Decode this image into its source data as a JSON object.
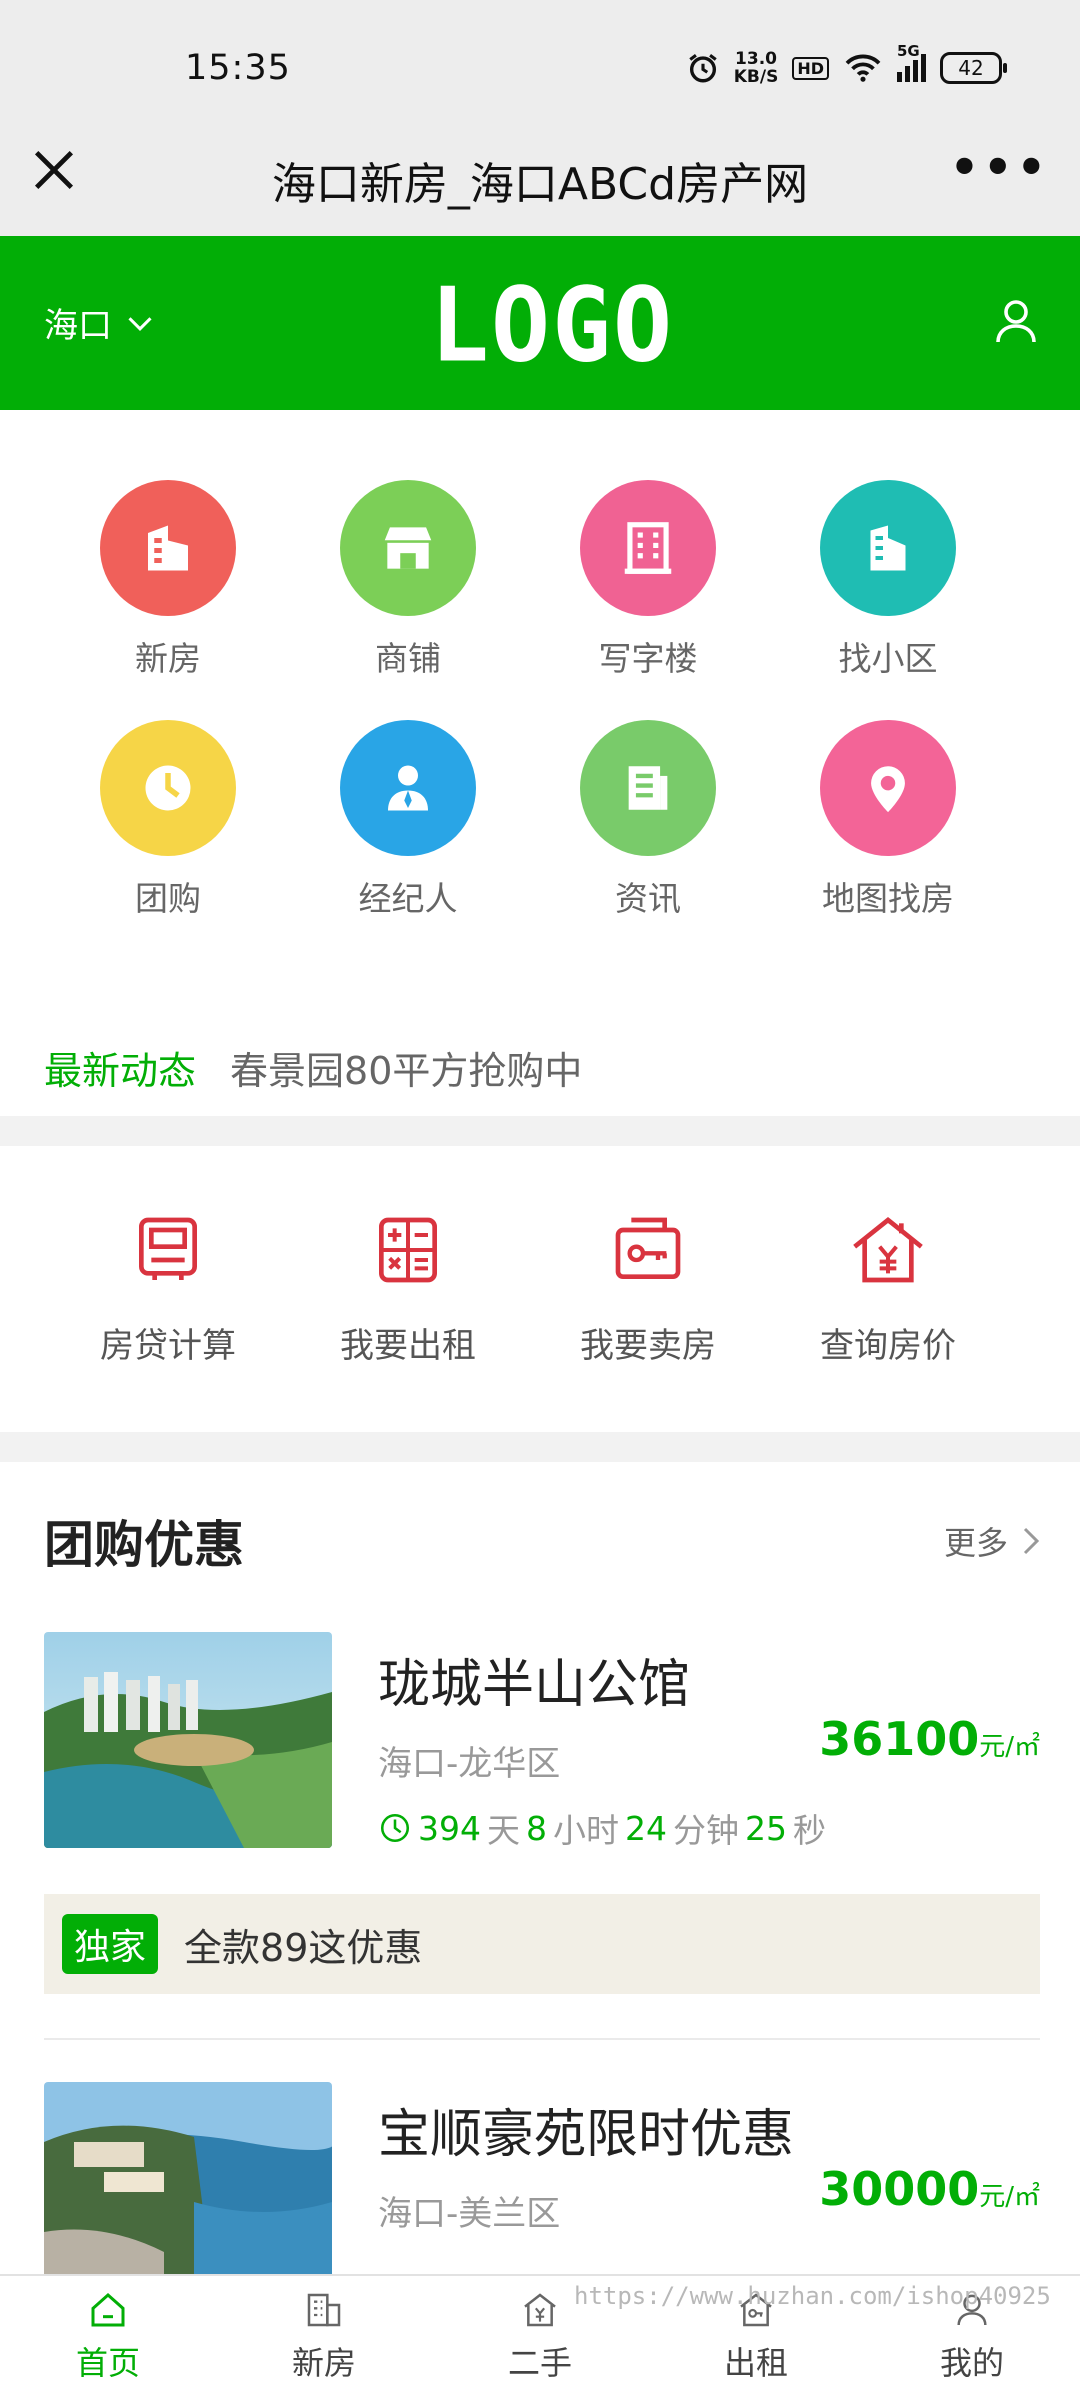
{
  "status": {
    "time": "15:35",
    "net_speed_value": "13.0",
    "net_speed_unit": "KB/S",
    "hd": "HD",
    "signal": "5G",
    "battery": "42"
  },
  "titlebar": {
    "title": "海口新房_海口ABCd房产网"
  },
  "header": {
    "city": "海口",
    "logo_text": "LOGO"
  },
  "grid": [
    {
      "label": "新房",
      "color": "#f0605a",
      "icon": "building-icon"
    },
    {
      "label": "商铺",
      "color": "#7ccf57",
      "icon": "shop-icon"
    },
    {
      "label": "写字楼",
      "color": "#f06293",
      "icon": "office-icon"
    },
    {
      "label": "找小区",
      "color": "#1fbdb3",
      "icon": "community-icon"
    },
    {
      "label": "团购",
      "color": "#f6d547",
      "icon": "clock-icon"
    },
    {
      "label": "经纪人",
      "color": "#29a5e6",
      "icon": "agent-icon"
    },
    {
      "label": "资讯",
      "color": "#79cb6a",
      "icon": "news-icon"
    },
    {
      "label": "地图找房",
      "color": "#f36497",
      "icon": "map-pin-icon"
    }
  ],
  "news": {
    "tag": "最新动态",
    "text": "春景园80平方抢购中"
  },
  "tools": [
    {
      "label": "房贷计算",
      "icon": "loan-calc-icon"
    },
    {
      "label": "我要出租",
      "icon": "calculator-icon"
    },
    {
      "label": "我要卖房",
      "icon": "key-box-icon"
    },
    {
      "label": "查询房价",
      "icon": "house-price-icon"
    }
  ],
  "section": {
    "title": "团购优惠",
    "more": "更多"
  },
  "listings": [
    {
      "name": "珑城半山公馆",
      "area": "海口-龙华区",
      "price": "36100",
      "unit": "元/㎡",
      "days": "394",
      "hours": "8",
      "minutes": "24",
      "seconds": "25",
      "promo_badge": "独家",
      "promo_text": "全款89这优惠"
    },
    {
      "name": "宝顺豪苑限时优惠",
      "area": "海口-美兰区",
      "price": "30000",
      "unit": "元/㎡",
      "days": "",
      "hours": "",
      "minutes": "",
      "seconds": ""
    }
  ],
  "countdown_units": {
    "day": "天",
    "hour": "小时",
    "minute": "分钟",
    "second": "秒"
  },
  "bottomnav": [
    {
      "label": "首页",
      "icon": "home-icon",
      "active": true
    },
    {
      "label": "新房",
      "icon": "new-house-icon",
      "active": false
    },
    {
      "label": "二手",
      "icon": "second-hand-icon",
      "active": false
    },
    {
      "label": "出租",
      "icon": "rent-icon",
      "active": false
    },
    {
      "label": "我的",
      "icon": "profile-icon",
      "active": false
    }
  ],
  "watermark": "https://www.huzhan.com/ishop40925"
}
